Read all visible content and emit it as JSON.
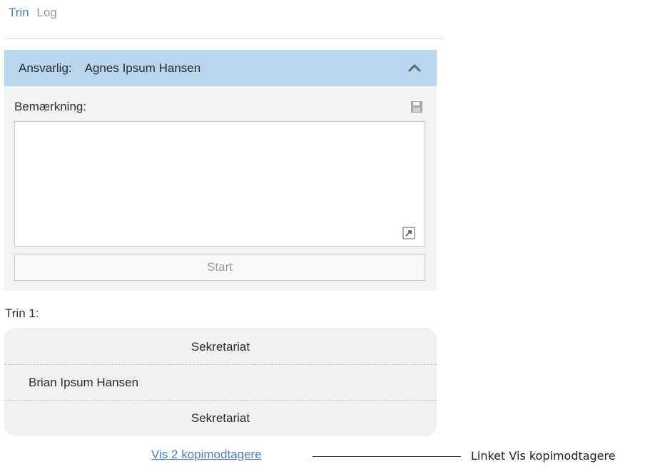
{
  "tabs": [
    {
      "label": "Trin",
      "active": true
    },
    {
      "label": "Log",
      "active": false
    }
  ],
  "panel": {
    "responsible_label": "Ansvarlig:",
    "responsible_name": "Agnes Ipsum Hansen",
    "collapse_icon": "chevron-up-icon",
    "remark_label": "Bemærkning:",
    "save_icon": "save-icon",
    "remark_value": "",
    "expand_icon": "expand-icon",
    "start_label": "Start"
  },
  "steps": {
    "title": "Trin 1:",
    "rows": [
      "Sekretariat",
      "Brian Ipsum Hansen",
      "Sekretariat"
    ]
  },
  "copy_link": "Vis 2 kopimodtagere",
  "callout": "Linket Vis kopimodtagere",
  "colors": {
    "accent": "#4a7fc7",
    "header_bg": "#b8d6ee",
    "panel_bg": "#f2f2f2"
  }
}
